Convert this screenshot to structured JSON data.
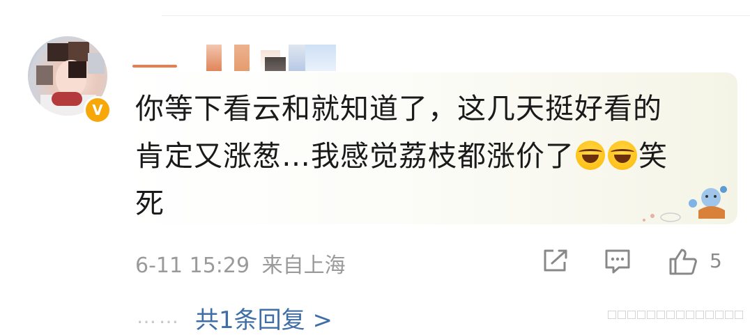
{
  "comment": {
    "text_line1": "你等下看云和就知道了，这几天挺好看的",
    "text_line2_a": "肯定又涨葱…我感觉荔枝都涨价了",
    "text_line2_b": "笑",
    "text_line3": "死",
    "emoji_name": "laugh-cry-emoji",
    "verified_badge": "V"
  },
  "meta": {
    "timestamp": "6-11 15:29",
    "location": "来自上海"
  },
  "actions": {
    "like_count": "5",
    "share_icon": "share-icon",
    "comment_icon": "comment-icon",
    "like_icon": "thumbs-up-icon"
  },
  "replies": {
    "dots": "……",
    "label": "共1条回复 >"
  },
  "colors": {
    "link": "#3f6ea6",
    "meta": "#9a9a9a",
    "badge": "#f7a708"
  }
}
